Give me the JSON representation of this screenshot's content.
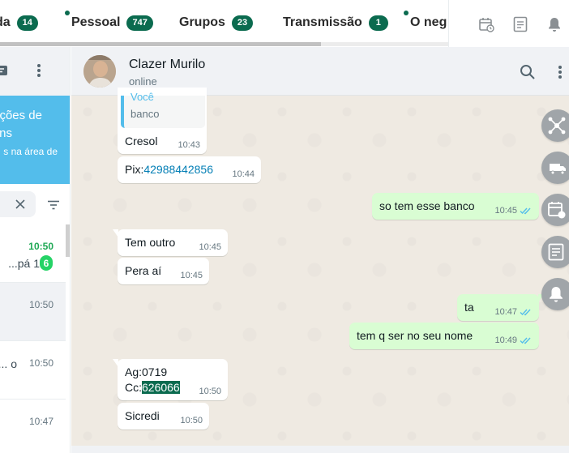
{
  "tabs": [
    {
      "label": "da",
      "count": "14"
    },
    {
      "label": "Pessoal",
      "count": "747"
    },
    {
      "label": "Grupos",
      "count": "23"
    },
    {
      "label": "Transmissão",
      "count": "1"
    },
    {
      "label": "O neg",
      "count": ""
    }
  ],
  "top_actions": [
    "calendar-clock-icon",
    "document-icon",
    "bell-icon"
  ],
  "sidebar": {
    "banner": {
      "line1": "ções de",
      "line2": "ns",
      "line3": "s na área de"
    },
    "chats": [
      {
        "time": "10:50",
        "preview": "1 pá...",
        "unread": "6"
      },
      {
        "time": "10:50",
        "preview": ""
      },
      {
        "time": "10:50",
        "preview": "o ..."
      },
      {
        "time": "10:47",
        "preview": ""
      }
    ]
  },
  "conversation": {
    "contact_name": "Clazer Murilo",
    "status": "online",
    "quoted": {
      "author": "Você",
      "text": "banco"
    },
    "messages": [
      {
        "dir": "in",
        "text": "Cresol",
        "time": "10:43"
      },
      {
        "dir": "in",
        "prefix": "Pix:",
        "link": "42988442856",
        "time": "10:44"
      },
      {
        "dir": "out",
        "text": "so tem esse banco",
        "time": "10:45"
      },
      {
        "dir": "in",
        "text": "Tem outro",
        "time": "10:45"
      },
      {
        "dir": "in",
        "text": "Pera aí",
        "time": "10:45"
      },
      {
        "dir": "out",
        "text": "ta",
        "time": "10:47"
      },
      {
        "dir": "out",
        "text": "tem q ser no seu nome",
        "time": "10:49"
      },
      {
        "dir": "in",
        "line1": "Ag:0719",
        "line2_prefix": "Cc:",
        "line2_selected": "626066",
        "time": "10:50"
      },
      {
        "dir": "in",
        "text": "Sicredi",
        "time": "10:50"
      }
    ]
  },
  "side_fabs": [
    "network-icon",
    "delivery-truck-icon",
    "calendar-schedule-icon",
    "notes-icon",
    "bell-icon"
  ],
  "colors": {
    "accent": "#0b6b4f",
    "outgoing_bubble": "#d9fdd3",
    "banner": "#53bdeb",
    "unread": "#25d366",
    "link": "#027eb5"
  }
}
